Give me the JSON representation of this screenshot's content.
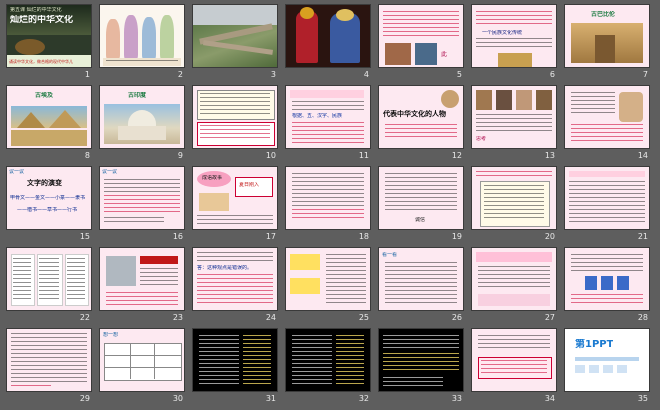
{
  "slides": [
    {
      "num": "1",
      "title": "灿烂的中华文化",
      "sub": "第五课 灿烂的中华文化",
      "caption": "诵读中华文化，做合格的现代中华儿"
    },
    {
      "num": "2"
    },
    {
      "num": "3"
    },
    {
      "num": "4"
    },
    {
      "num": "5",
      "caption": "此"
    },
    {
      "num": "6",
      "caption": "一个民族文化传统"
    },
    {
      "num": "7",
      "title": "古巴比伦"
    },
    {
      "num": "8",
      "title": "古埃及"
    },
    {
      "num": "9",
      "title": "古印度"
    },
    {
      "num": "10"
    },
    {
      "num": "11",
      "highlight": "根据、五、汉字、民族"
    },
    {
      "num": "12",
      "title": "代表中华文化的人物"
    },
    {
      "num": "13",
      "caption": "思考"
    },
    {
      "num": "14"
    },
    {
      "num": "15",
      "label": "议一议",
      "title": "文字的演变",
      "row1": "甲骨文——金文——小篆——隶书",
      "row2": "——楷书——草书——行书"
    },
    {
      "num": "16",
      "label": "议一议"
    },
    {
      "num": "17",
      "bubble1": "成语故事",
      "bubble2": "夏日刚入"
    },
    {
      "num": "18"
    },
    {
      "num": "19",
      "caption": "诚信"
    },
    {
      "num": "20"
    },
    {
      "num": "21"
    },
    {
      "num": "22"
    },
    {
      "num": "23"
    },
    {
      "num": "24",
      "caption": "答：这种观点是错误的。"
    },
    {
      "num": "25"
    },
    {
      "num": "26",
      "label": "看一看"
    },
    {
      "num": "27"
    },
    {
      "num": "28"
    },
    {
      "num": "29"
    },
    {
      "num": "30",
      "label": "想一想"
    },
    {
      "num": "31"
    },
    {
      "num": "32"
    },
    {
      "num": "33"
    },
    {
      "num": "34"
    },
    {
      "num": "35",
      "brand": "第1PPT"
    }
  ]
}
